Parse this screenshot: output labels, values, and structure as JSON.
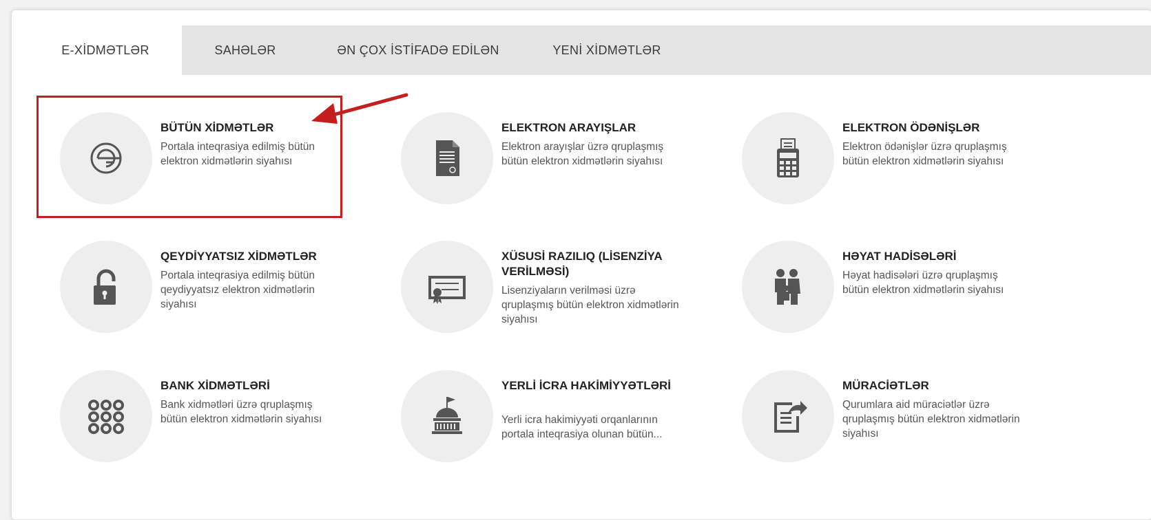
{
  "tabs": [
    {
      "label": "E-XİDMƏTLƏR",
      "active": true
    },
    {
      "label": "SAHƏLƏR",
      "active": false
    },
    {
      "label": "ƏN ÇOX İSTİFADƏ EDİLƏN",
      "active": false
    },
    {
      "label": "YENİ XİDMƏTLƏR",
      "active": false
    }
  ],
  "cards": [
    {
      "title": "BÜTÜN XİDMƏTLƏR",
      "desc": "Portala inteqrasiya edilmiş bütün elektron xidmətlərin siyahısı",
      "icon": "e-gov-logo-icon"
    },
    {
      "title": "ELEKTRON ARAYIŞLAR",
      "desc": "Elektron arayışlar üzrə qruplaşmış bütün elektron xidmətlərin siyahısı",
      "icon": "document-icon"
    },
    {
      "title": "ELEKTRON ÖDƏNİŞLƏR",
      "desc": "Elektron ödənişlər üzrə qruplaşmış bütün elektron xidmətlərin siyahısı",
      "icon": "payment-terminal-icon"
    },
    {
      "title": "QEYDİYYATSIZ XİDMƏTLƏR",
      "desc": "Portala inteqrasiya edilmiş bütün qeydiyyatsız elektron xidmətlərin siyahısı",
      "icon": "unlocked-padlock-icon"
    },
    {
      "title": "XÜSUSİ RAZILIQ (LİSENZİYA VERİLMƏSİ)",
      "desc": "Lisenziyaların verilməsi üzrə qruplaşmış bütün elektron xidmətlərin siyahısı",
      "icon": "certificate-icon"
    },
    {
      "title": "HƏYAT HADİSƏLƏRİ",
      "desc": "Həyat hadisələri üzrə qruplaşmış bütün elektron xidmətlərin siyahısı",
      "icon": "family-icon"
    },
    {
      "title": "BANK XİDMƏTLƏRİ",
      "desc": "Bank xidmətləri üzrə qruplaşmış bütün elektron xidmətlərin siyahısı",
      "icon": "keypad-grid-icon"
    },
    {
      "title": "YERLİ İCRA HAKİMİYYƏTLƏRİ",
      "desc": "Yerli icra hakimiyyəti orqanlarının portala inteqrasiya olunan bütün...",
      "icon": "government-building-icon"
    },
    {
      "title": "MÜRACİƏTLƏR",
      "desc": "Qurumlara aid müraciətlər üzrə qruplaşmış bütün elektron xidmətlərin siyahısı",
      "icon": "edit-document-icon"
    }
  ],
  "colors": {
    "highlight": "#c41e1e",
    "icon": "#555555",
    "circle": "#eeeeee",
    "tabbar": "#e4e4e4"
  }
}
